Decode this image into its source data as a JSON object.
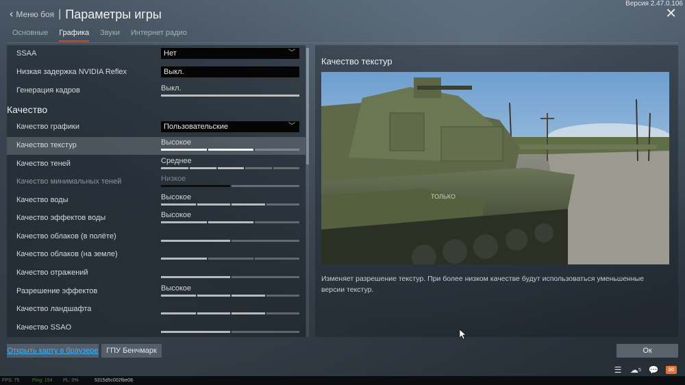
{
  "version": "Версия 2.47.0.106",
  "header": {
    "back_label": "Меню боя",
    "separator": "|",
    "title": "Параметры игры"
  },
  "tabs": [
    {
      "label": "Основные"
    },
    {
      "label": "Графика"
    },
    {
      "label": "Звуки"
    },
    {
      "label": "Интернет радио"
    }
  ],
  "settings": {
    "ssaa": {
      "label": "SSAA",
      "value": "Нет"
    },
    "reflex": {
      "label": "Низкая задержка NVIDIA Reflex",
      "value": "Выкл."
    },
    "framegen": {
      "label": "Генерация кадров",
      "value": "Выкл.",
      "level": 1.0
    },
    "section_title": "Качество",
    "graphics_quality": {
      "label": "Качество графики",
      "value": "Пользовательские"
    },
    "texture_quality": {
      "label": "Качество текстур",
      "value": "Высокое",
      "level": 0.67
    },
    "shadow_quality": {
      "label": "Качество теней",
      "value": "Среднее",
      "level": 0.6
    },
    "min_shadow_quality": {
      "label": "Качество минимальных теней",
      "value": "Низкое",
      "level": 0.5
    },
    "water_quality": {
      "label": "Качество воды",
      "value": "Высокое",
      "level": 0.75
    },
    "water_fx_quality": {
      "label": "Качество эффектов воды",
      "value": "Высокое",
      "level": 0.67
    },
    "clouds_flight": {
      "label": "Качество облаков (в полёте)",
      "level": 0.5
    },
    "clouds_ground": {
      "label": "Качество облаков (на земле)",
      "level": 0.33
    },
    "reflections": {
      "label": "Качество отражений",
      "level": 0.5
    },
    "fx_resolution": {
      "label": "Разрешение эффектов",
      "value": "Высокое",
      "level": 0.75
    },
    "landscape": {
      "label": "Качество ландшафта",
      "level": 0.75
    },
    "ssao": {
      "label": "Качество SSAO",
      "level": 0.5
    }
  },
  "detail": {
    "title": "Качество текстур",
    "description": "Изменяет разрешение текстур. При более низком качестве будут использоваться уменьшенные версии текстур.",
    "image_text": "ТОЛЬКО"
  },
  "buttons": {
    "open_map": "Открыть карту в браузере",
    "gpu_bench": "ГПУ Бенчмарк",
    "ok": "Ок"
  },
  "status_bar": {
    "fps": "FPS: 75",
    "ping": "Ping: 154",
    "pl": "PL: 0%",
    "session": "5315d5c002fbe08"
  },
  "icons": [
    "list-icon",
    "squad-icon",
    "chat-icon",
    "mail-icon"
  ],
  "squad_count": "5",
  "colors": {
    "accent": "#d2492a",
    "link": "#3ab3ff",
    "mail": "#e0733a"
  }
}
